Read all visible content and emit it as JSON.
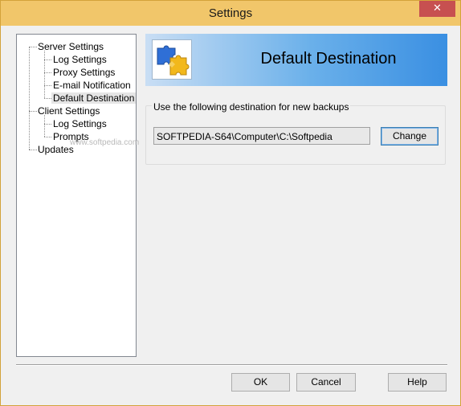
{
  "window": {
    "title": "Settings",
    "close_glyph": "✕"
  },
  "tree": {
    "items": [
      {
        "label": "Server Settings"
      },
      {
        "label": "Log Settings"
      },
      {
        "label": "Proxy Settings"
      },
      {
        "label": "E-mail Notification"
      },
      {
        "label": "Default Destination"
      },
      {
        "label": "Client Settings"
      },
      {
        "label": "Log Settings"
      },
      {
        "label": "Prompts"
      },
      {
        "label": "Updates"
      }
    ],
    "selected": "Default Destination"
  },
  "header": {
    "title": "Default Destination",
    "icon": "puzzle-icon"
  },
  "destination": {
    "group_label": "Use the following destination for new backups",
    "path": "SOFTPEDIA-S64\\Computer\\C:\\Softpedia",
    "change_label": "Change"
  },
  "footer": {
    "ok_label": "OK",
    "cancel_label": "Cancel",
    "help_label": "Help"
  },
  "watermark": "www.softpedia.com"
}
